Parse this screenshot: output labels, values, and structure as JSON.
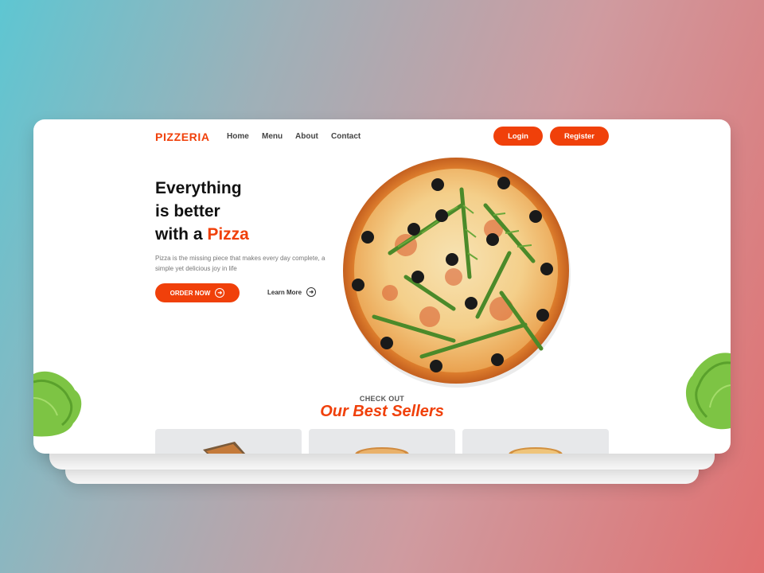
{
  "brand": {
    "name": "PIZZERIA",
    "accent_color": "#f0400a"
  },
  "nav": {
    "links": [
      "Home",
      "Menu",
      "About",
      "Contact"
    ],
    "login_label": "Login",
    "register_label": "Register"
  },
  "hero": {
    "title_line1": "Everything",
    "title_line2": "is better",
    "title_line3_prefix": "with a ",
    "title_line3_accent": "Pizza",
    "description": "Pizza is the missing piece that makes every day complete, a simple yet delicious joy in life",
    "order_label": "ORDER NOW",
    "learn_more_label": "Learn More",
    "arrow_icon": "arrow-right-circle-icon"
  },
  "best_sellers": {
    "eyebrow": "CHECK OUT",
    "title": "Our Best Sellers",
    "products": [
      {
        "image": "pizza-box-image"
      },
      {
        "image": "pizza-image"
      },
      {
        "image": "pizza-image"
      }
    ]
  }
}
